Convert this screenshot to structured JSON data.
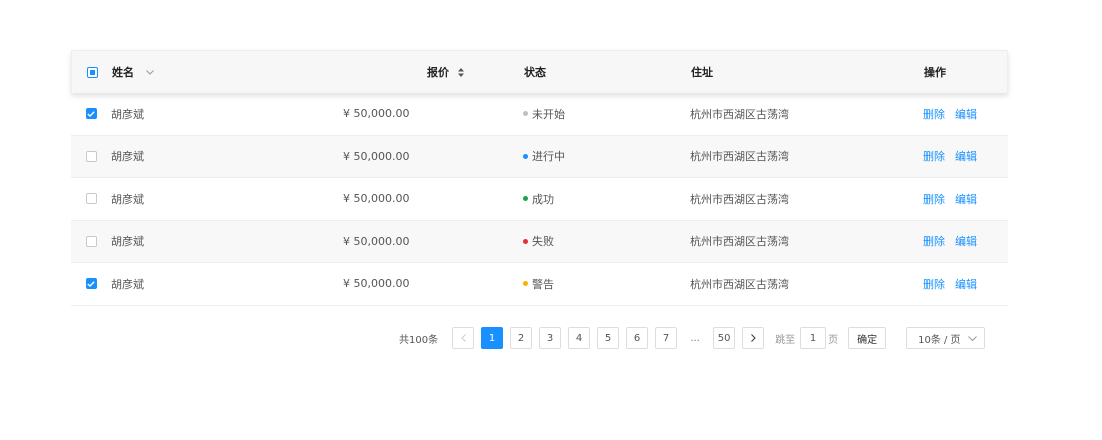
{
  "table": {
    "headers": {
      "name": "姓名",
      "price": "报价",
      "status": "状态",
      "address": "住址",
      "actions": "操作"
    },
    "rows": [
      {
        "checked": true,
        "name": "胡彦斌",
        "price": "¥ 50,000.00",
        "status": "未开始",
        "status_color": "#bfbfbf",
        "address": "杭州市西湖区古荡湾",
        "delete": "删除",
        "edit": "编辑"
      },
      {
        "checked": false,
        "name": "胡彦斌",
        "price": "¥ 50,000.00",
        "status": "进行中",
        "status_color": "#1890ff",
        "address": "杭州市西湖区古荡湾",
        "delete": "删除",
        "edit": "编辑"
      },
      {
        "checked": false,
        "name": "胡彦斌",
        "price": "¥ 50,000.00",
        "status": "成功",
        "status_color": "#1aa34a",
        "address": "杭州市西湖区古荡湾",
        "delete": "删除",
        "edit": "编辑"
      },
      {
        "checked": false,
        "name": "胡彦斌",
        "price": "¥ 50,000.00",
        "status": "失败",
        "status_color": "#e5302f",
        "address": "杭州市西湖区古荡湾",
        "delete": "删除",
        "edit": "编辑"
      },
      {
        "checked": true,
        "name": "胡彦斌",
        "price": "¥ 50,000.00",
        "status": "警告",
        "status_color": "#f5b400",
        "address": "杭州市西湖区古荡湾",
        "delete": "删除",
        "edit": "编辑"
      }
    ]
  },
  "pagination": {
    "total": "共100条",
    "pages": [
      "1",
      "2",
      "3",
      "4",
      "5",
      "6",
      "7"
    ],
    "current": "1",
    "ellipsis": "...",
    "last": "50",
    "jump_label": "跳至",
    "jump_value": "1",
    "page_label": "页",
    "confirm": "确定",
    "page_size": "10条 / 页"
  },
  "colors": {
    "accent": "#1890ff"
  }
}
